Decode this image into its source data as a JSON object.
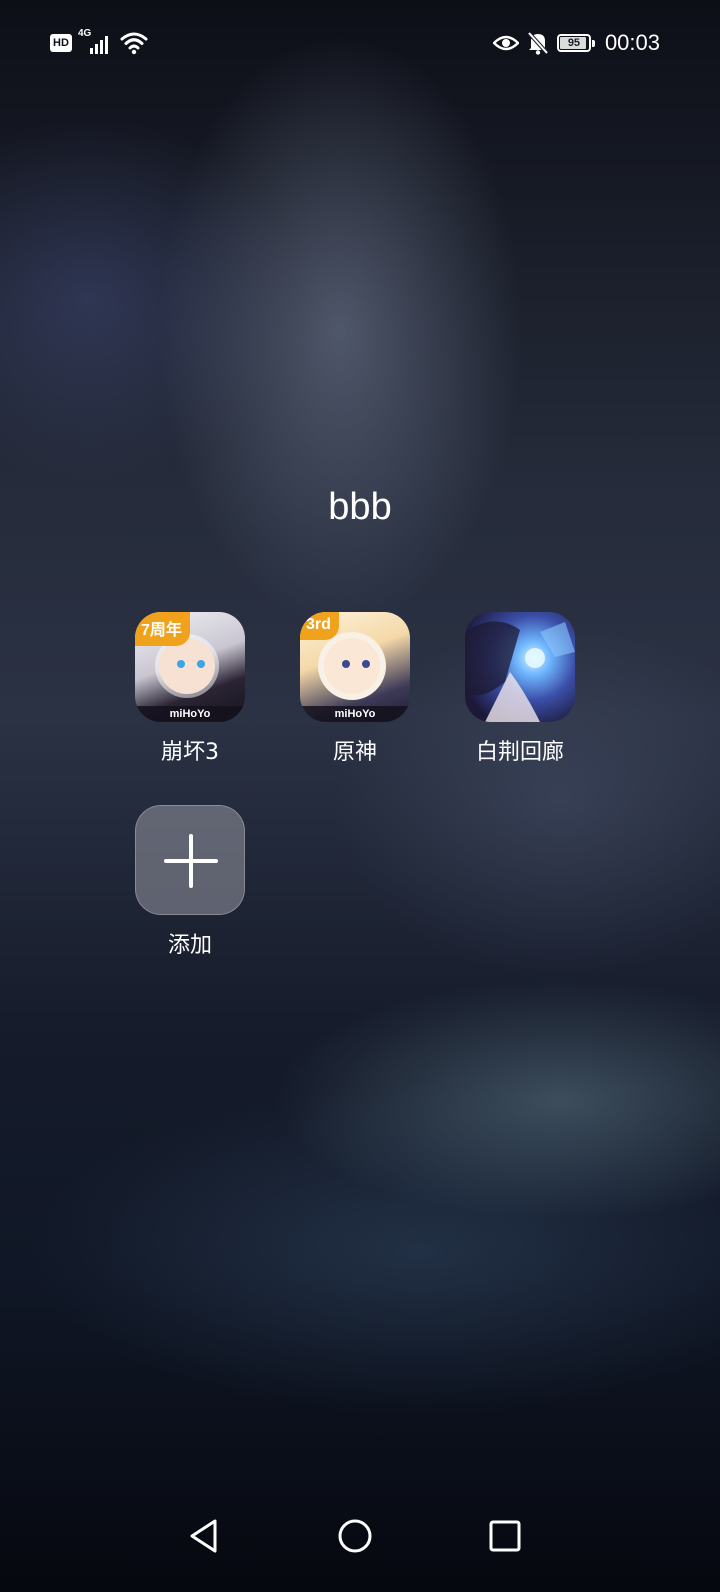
{
  "status_bar": {
    "hd_label": "HD",
    "network_label": "4G",
    "battery_level": "95",
    "battery_fraction": 0.95,
    "time": "00:03",
    "icons": [
      "signal-icon",
      "wifi-icon",
      "eye-icon",
      "bell-off-icon",
      "battery-icon"
    ]
  },
  "folder": {
    "title": "bbb",
    "apps": [
      {
        "label": "崩坏3",
        "icon": "honkai-impact-3-icon",
        "badge": "7周年",
        "brand": "miHoYo"
      },
      {
        "label": "原神",
        "icon": "genshin-impact-icon",
        "badge": "3rd",
        "brand": "miHoYo"
      },
      {
        "label": "白荆回廊",
        "icon": "path-to-nowhere-icon"
      }
    ],
    "add_label": "添加"
  },
  "nav_bar": {
    "buttons": [
      "back-icon",
      "home-icon",
      "recents-icon"
    ]
  },
  "colors": {
    "text": "#ffffff",
    "badge_orange": "#f0a21c"
  }
}
